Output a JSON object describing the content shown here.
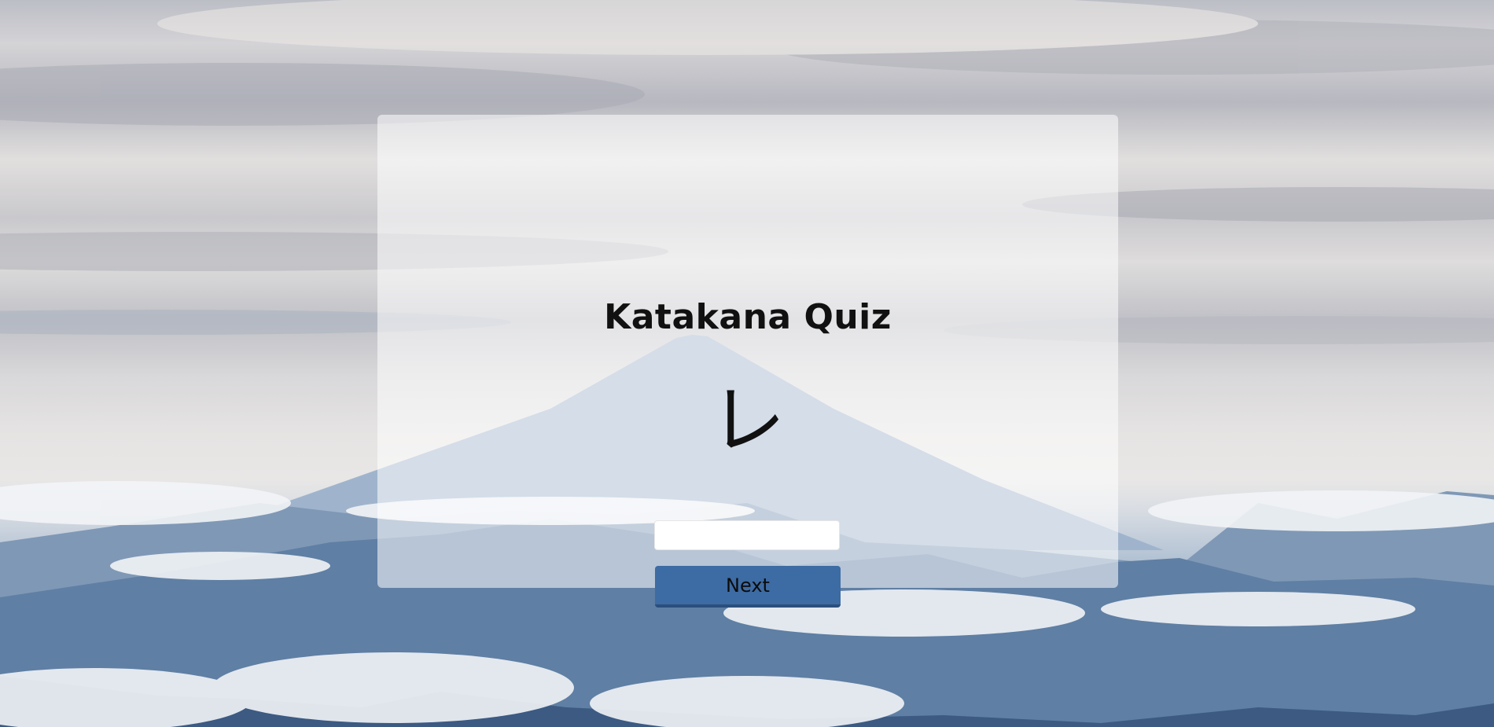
{
  "quiz": {
    "title": "Katakana Quiz",
    "character": "レ",
    "answer_value": "",
    "answer_placeholder": "",
    "next_label": "Next"
  },
  "colors": {
    "button_bg": "#3d6ba3",
    "card_bg": "rgba(255,255,255,0.55)",
    "sky": "#d9d8da",
    "mountain": "#7f9bbb"
  },
  "background": {
    "subject": "mountain-above-clouds"
  }
}
